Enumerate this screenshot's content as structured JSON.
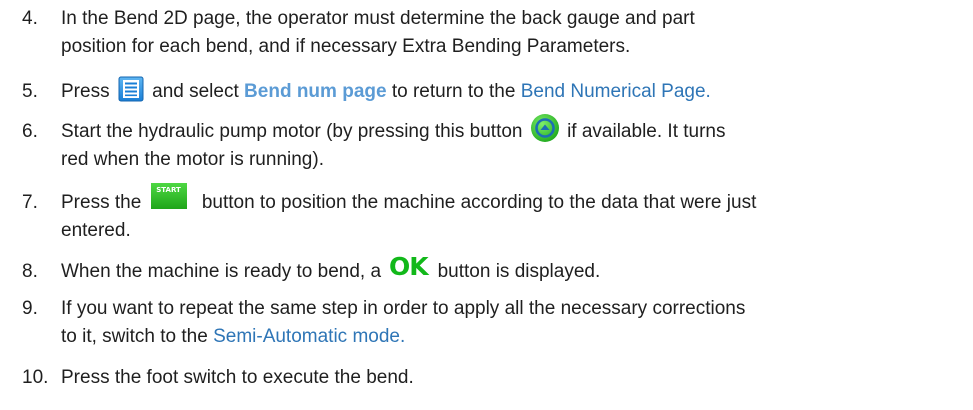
{
  "steps": [
    {
      "number": "4.",
      "line1": "In the Bend 2D page, the operator must determine the back gauge and part",
      "line2": "position for each bend, and if necessary Extra Bending Parameters."
    },
    {
      "number": "5.",
      "pre": "Press",
      "mid": "and select",
      "menu_item": "Bend num page",
      "post": "to return to the",
      "link": "Bend Numerical Page."
    },
    {
      "number": "6.",
      "line1_pre": "Start the hydraulic pump motor (by pressing this button",
      "line1_post": "if available. It turns",
      "line2": "red when the motor is running)."
    },
    {
      "number": "7.",
      "line1_pre": "Press the",
      "line1_post": "button to position the machine according to the data that were just",
      "line2": "entered."
    },
    {
      "number": "8.",
      "pre": "When the machine is ready to bend, a",
      "post": "button is displayed."
    },
    {
      "number": "9.",
      "line1": "If you want to repeat the same step in order to apply all the necessary corrections",
      "line2_pre": "to it, switch to the",
      "line2_link": "Semi-Automatic mode."
    },
    {
      "number": "10.",
      "line1": "Press the foot switch to execute the bend."
    }
  ],
  "icons": {
    "menu_icon": "menu-list-icon",
    "pump_icon": "pump-motor-icon",
    "start_button_label": "START",
    "ok_button_label": "OK"
  },
  "colors": {
    "text": "#1f1f1f",
    "link": "#2e75b6",
    "menu_link": "#5b9bd5",
    "start_green": "#1fa51a",
    "ok_green": "#12b81a",
    "pump_green": "#2ecc40",
    "menu_blue": "#1a7fd6"
  }
}
